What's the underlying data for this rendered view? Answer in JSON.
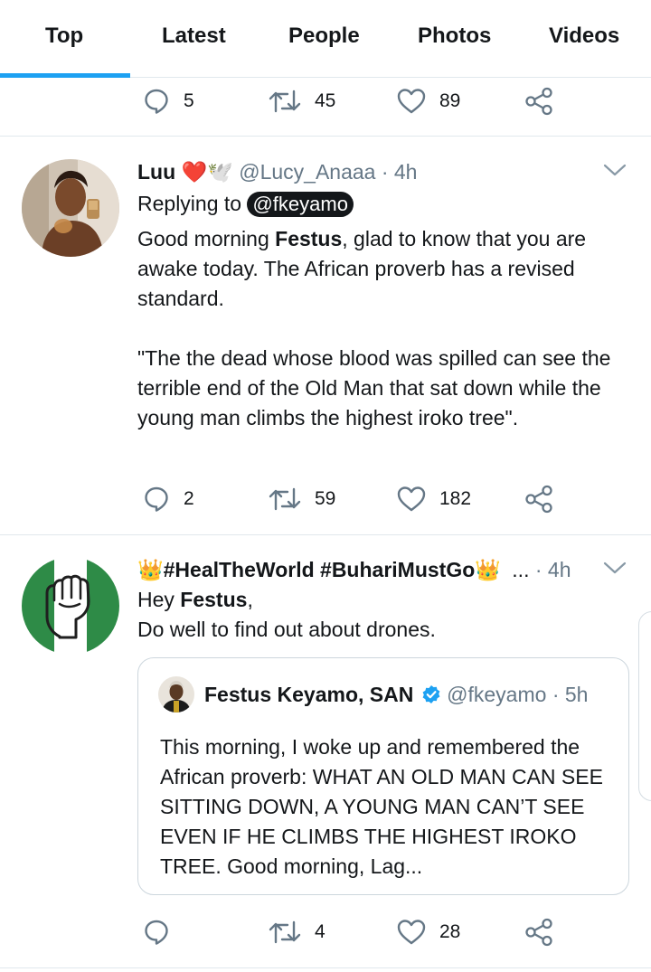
{
  "tabs": [
    {
      "label": "Top",
      "active": true
    },
    {
      "label": "Latest"
    },
    {
      "label": "People"
    },
    {
      "label": "Photos"
    },
    {
      "label": "Videos"
    }
  ],
  "accent_color": "#1da1f2",
  "prev_tweet": {
    "replies": "5",
    "retweets": "45",
    "likes": "89"
  },
  "tweet1": {
    "name": "Luu",
    "emoji": "❤️🕊️",
    "handle": "@Lucy_Anaaa",
    "time": "· 4h",
    "replying_prefix": "Replying to",
    "replying_to": "@fkeyamo",
    "text_a": "Good morning ",
    "text_bold": "Festus",
    "text_b": ", glad to know that you are awake today. The African proverb has a revised standard.",
    "text_quote": "\"The the dead whose blood was spilled can see the terrible end of the Old Man that sat down while the young man climbs the highest iroko tree\".",
    "replies": "2",
    "retweets": "59",
    "likes": "182"
  },
  "tweet2": {
    "name": "👑#HealTheWorld #BuhariMustGo👑",
    "ellipsis": "...",
    "time": "· 4h",
    "line1_a": "Hey ",
    "line1_bold": "Festus",
    "line1_b": ",",
    "line2": "Do well to find out about drones.",
    "replies": "",
    "retweets": "4",
    "likes": "28"
  },
  "quote": {
    "name": "Festus Keyamo, SAN",
    "handle": "@fkeyamo",
    "time": "· 5h",
    "text": "This morning, I woke up and remembered the African proverb: WHAT AN OLD MAN CAN SEE SITTING DOWN, A YOUNG MAN CAN’T SEE EVEN IF HE CLIMBS THE HIGHEST IROKO TREE. Good morning, Lag...",
    "verified_color": "#1da1f2"
  },
  "icons": {
    "reply": "reply-icon",
    "retweet": "retweet-icon",
    "like": "heart-icon",
    "share": "share-icon",
    "more": "chevron-down-icon",
    "verified": "verified-badge-icon"
  }
}
